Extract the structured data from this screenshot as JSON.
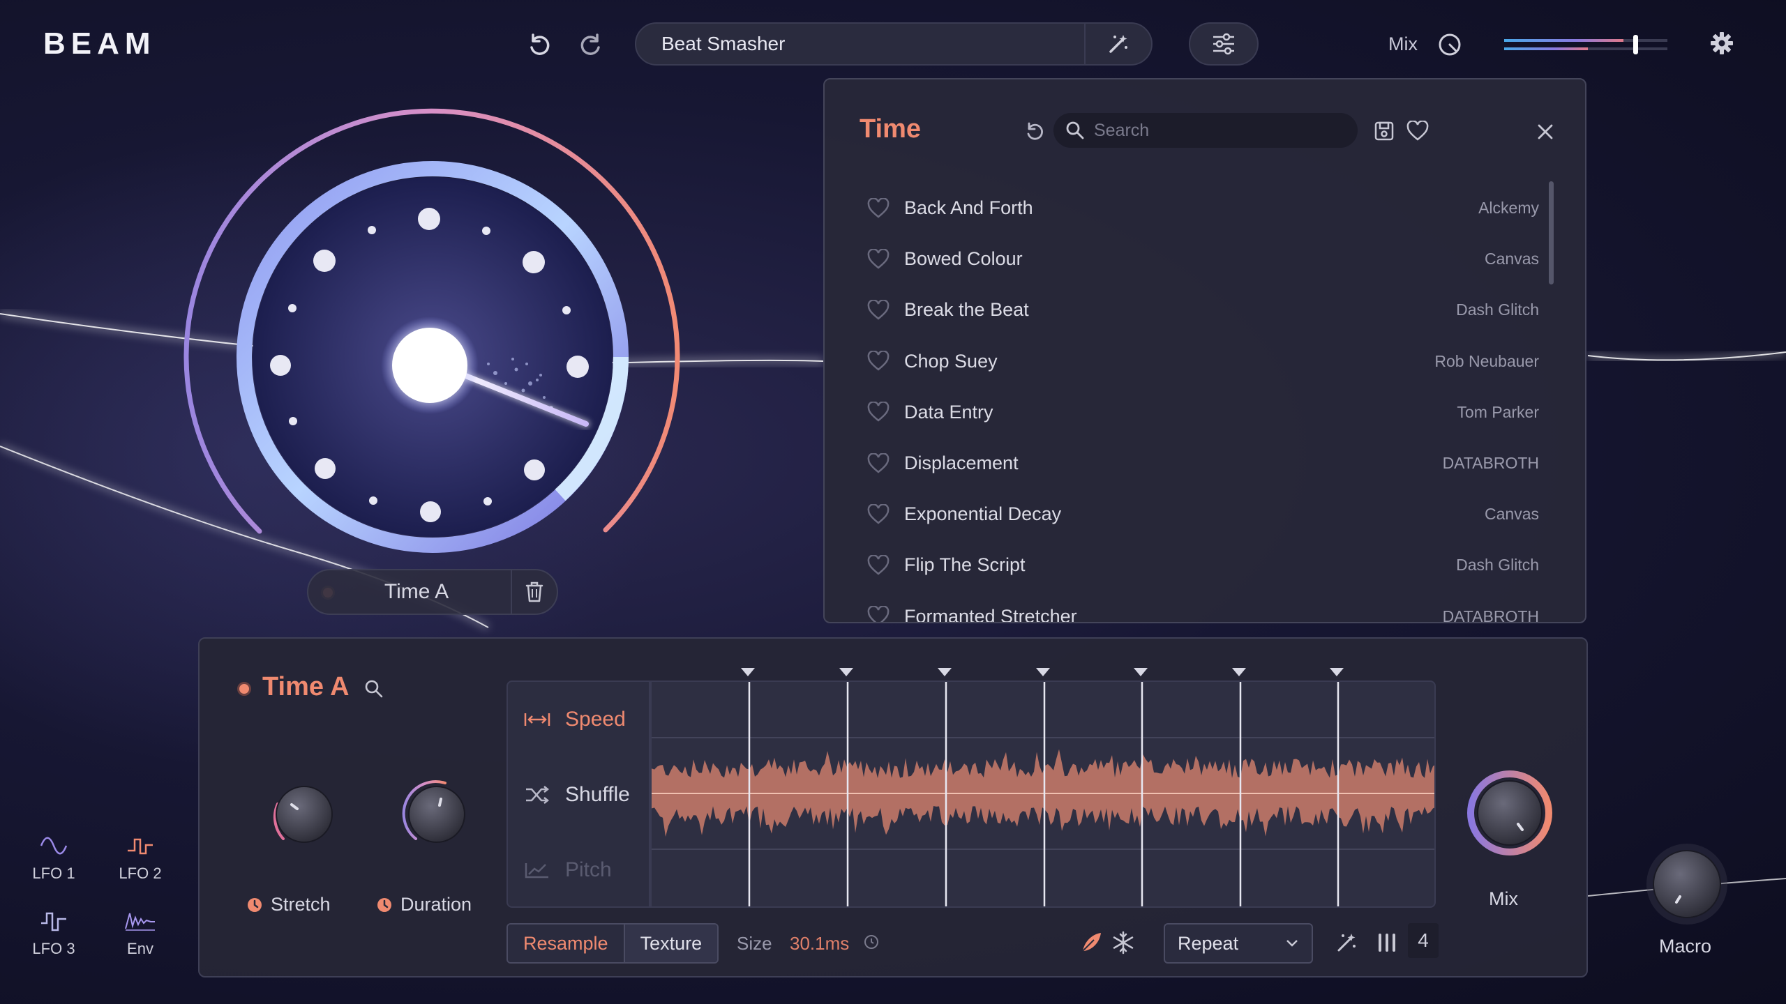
{
  "app": {
    "logo": "BEAM"
  },
  "topbar": {
    "preset_name": "Beat Smasher",
    "mix_label": "Mix",
    "mix_level": 0.73
  },
  "browser": {
    "title": "Time",
    "search_placeholder": "Search",
    "presets": [
      {
        "name": "Back And Forth",
        "author": "Alckemy"
      },
      {
        "name": "Bowed Colour",
        "author": "Canvas"
      },
      {
        "name": "Break the Beat",
        "author": "Dash Glitch"
      },
      {
        "name": "Chop Suey",
        "author": "Rob Neubauer"
      },
      {
        "name": "Data Entry",
        "author": "Tom Parker"
      },
      {
        "name": "Displacement",
        "author": "DATABROTH"
      },
      {
        "name": "Exponential Decay",
        "author": "Canvas"
      },
      {
        "name": "Flip The Script",
        "author": "Dash Glitch"
      },
      {
        "name": "Formanted Stretcher",
        "author": "DATABROTH"
      }
    ]
  },
  "dial": {
    "label": "Time A"
  },
  "module": {
    "title": "Time A",
    "knobs": {
      "stretch": "Stretch",
      "duration": "Duration",
      "mix": "Mix"
    },
    "modes": {
      "speed": "Speed",
      "shuffle": "Shuffle",
      "pitch": "Pitch"
    },
    "resample": "Resample",
    "texture": "Texture",
    "size_label": "Size",
    "size_value": "30.1ms",
    "repeat": "Repeat",
    "count": "4"
  },
  "modulators": {
    "lfo1": "LFO 1",
    "lfo2": "LFO 2",
    "lfo3": "LFO 3",
    "env": "Env"
  },
  "macro": {
    "label": "Macro"
  },
  "colors": {
    "accent": "#f08a70",
    "purple": "#9b8ae8",
    "background": "#171733"
  }
}
